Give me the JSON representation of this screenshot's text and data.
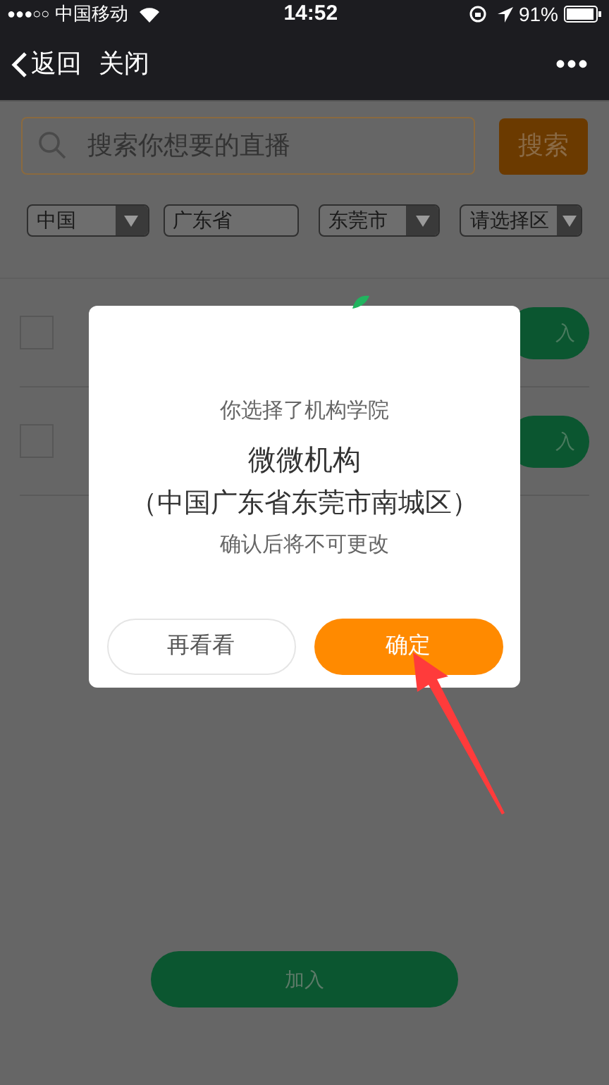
{
  "status_bar": {
    "signal": "●●●○○",
    "carrier": "中国移动",
    "time": "14:52",
    "battery": "91%"
  },
  "nav": {
    "back": "返回",
    "close": "关闭",
    "more": "•••"
  },
  "search": {
    "placeholder": "搜索你想要的直播",
    "button": "搜索"
  },
  "filters": [
    {
      "value": "中国",
      "dropdown": true
    },
    {
      "value": "广东省",
      "dropdown": false
    },
    {
      "value": "东莞市",
      "dropdown": true
    },
    {
      "value": "请选择区",
      "dropdown": true
    }
  ],
  "rows": [
    {
      "checked": false,
      "button": "入"
    },
    {
      "checked": false,
      "button": "入"
    }
  ],
  "join_button": "加入",
  "dialog": {
    "intro": "你选择了机构学院",
    "name": "微微机构",
    "location": "（中国广东省东莞市南城区）",
    "warning": "确认后将不可更改",
    "cancel": "再看看",
    "confirm": "确定"
  }
}
